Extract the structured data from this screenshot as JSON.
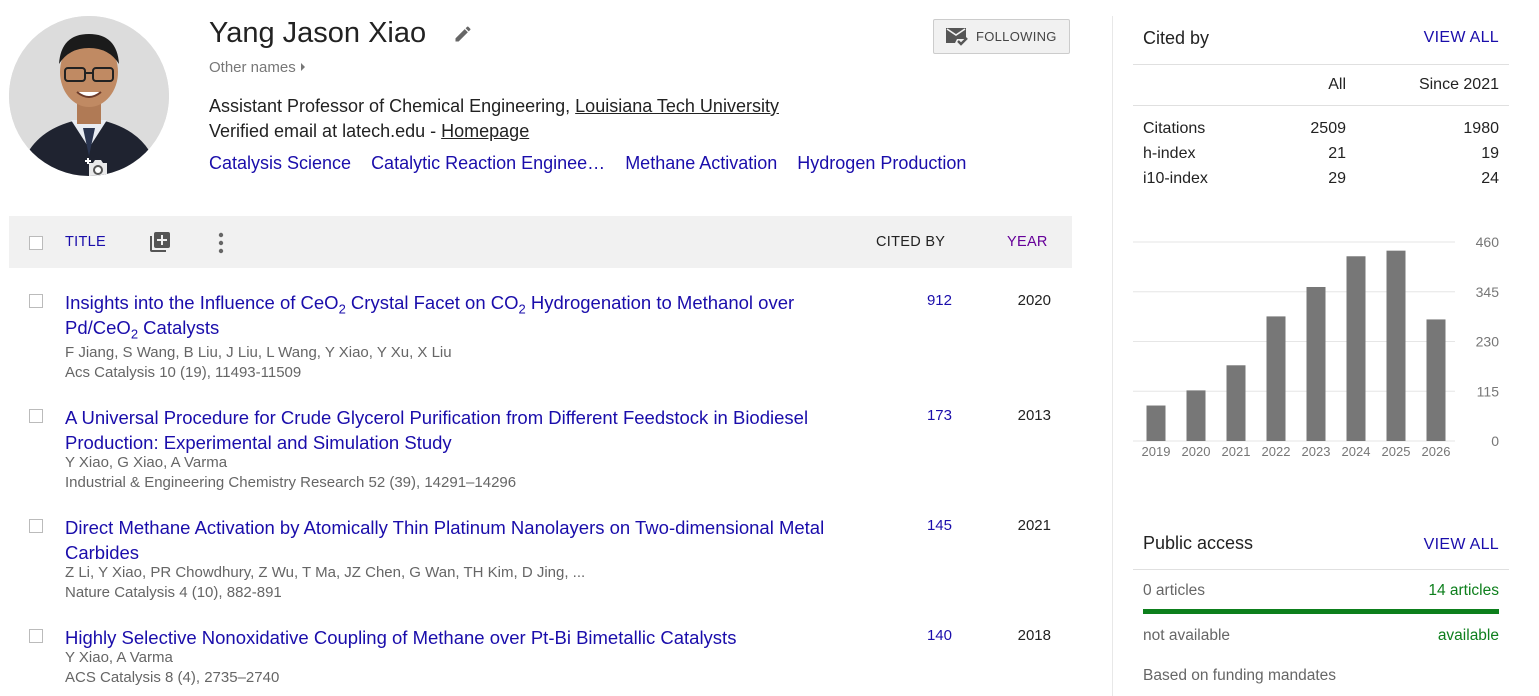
{
  "profile": {
    "name": "Yang Jason Xiao",
    "other_names": "Other names",
    "follow_label": "FOLLOWING",
    "affiliation_prefix": "Assistant Professor of Chemical Engineering, ",
    "affiliation_link": "Louisiana Tech University",
    "email_text": "Verified email at latech.edu - ",
    "homepage": "Homepage",
    "interests": [
      "Catalysis Science",
      "Catalytic Reaction Enginee…",
      "Methane Activation",
      "Hydrogen Production"
    ]
  },
  "table_header": {
    "title": "TITLE",
    "cited_by": "CITED BY",
    "year": "YEAR"
  },
  "articles": [
    {
      "title_parts": [
        "Insights into the Influence of CeO",
        "2",
        " Crystal Facet on CO",
        "2",
        " Hydrogenation to Methanol over Pd/CeO",
        "2",
        " Catalysts"
      ],
      "authors": "F Jiang, S Wang, B Liu, J Liu, L Wang, Y Xiao, Y Xu, X Liu",
      "venue": "Acs Catalysis 10 (19), 11493-11509",
      "cited": "912",
      "year": "2020"
    },
    {
      "title": "A Universal Procedure for Crude Glycerol Purification from Different Feedstock in Biodiesel Production: Experimental and Simulation Study",
      "authors": "Y Xiao, G Xiao, A Varma",
      "venue": "Industrial & Engineering Chemistry Research 52 (39), 14291–14296",
      "cited": "173",
      "year": "2013"
    },
    {
      "title": "Direct Methane Activation by Atomically Thin Platinum Nanolayers on Two-dimensional Metal Carbides",
      "authors": "Z Li, Y Xiao, PR Chowdhury, Z Wu, T Ma, JZ Chen, G Wan, TH Kim, D Jing, ...",
      "venue": "Nature Catalysis 4 (10), 882-891",
      "cited": "145",
      "year": "2021"
    },
    {
      "title": "Highly Selective Nonoxidative Coupling of Methane over Pt-Bi Bimetallic Catalysts",
      "authors": "Y Xiao, A Varma",
      "venue": "ACS Catalysis 8 (4), 2735–2740",
      "cited": "140",
      "year": "2018"
    }
  ],
  "cited_by": {
    "title": "Cited by",
    "view_all": "VIEW ALL",
    "col_all": "All",
    "col_since": "Since 2021",
    "rows": [
      {
        "label": "Citations",
        "all": "2509",
        "since": "1980"
      },
      {
        "label": "h-index",
        "all": "21",
        "since": "19"
      },
      {
        "label": "i10-index",
        "all": "29",
        "since": "24"
      }
    ]
  },
  "chart_data": {
    "type": "bar",
    "categories": [
      "2019",
      "2020",
      "2021",
      "2022",
      "2023",
      "2024",
      "2025",
      "2026"
    ],
    "values": [
      82,
      117,
      175,
      288,
      356,
      427,
      440,
      281
    ],
    "ylim": [
      0,
      460
    ],
    "yticks": [
      "460",
      "345",
      "230",
      "115",
      "0"
    ],
    "bar_color": "#777777",
    "grid": true
  },
  "public_access": {
    "title": "Public access",
    "view_all": "VIEW ALL",
    "not_available_count": "0 articles",
    "available_count": "14 articles",
    "not_available_label": "not available",
    "available_label": "available",
    "note": "Based on funding mandates",
    "available_fraction": 1.0,
    "available_color": "#0d7f1c"
  }
}
